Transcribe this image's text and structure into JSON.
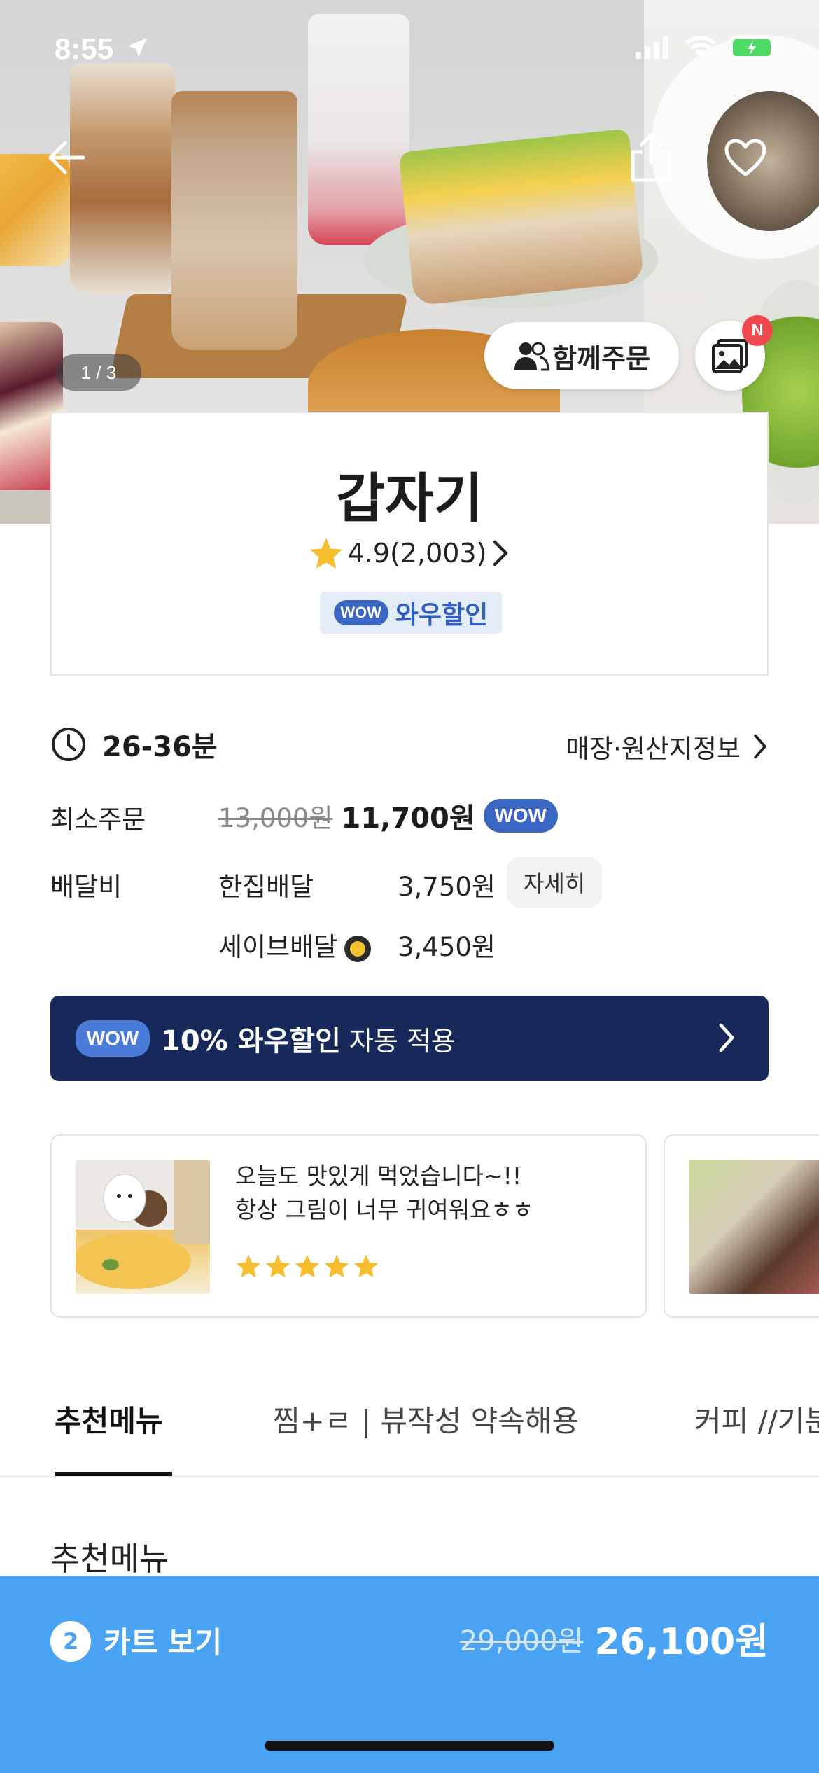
{
  "status_bar": {
    "time": "8:55"
  },
  "hero": {
    "counter": "1 / 3",
    "group_order_label": "함께주문",
    "photo_new_badge": "N"
  },
  "store": {
    "name": "갑자기",
    "rating": "4.9(2,003)",
    "wow_badge": "WOW",
    "wow_discount_label": "와우할인"
  },
  "delivery": {
    "time": "26-36분",
    "store_info_link": "매장·원산지정보",
    "min_order_label": "최소주문",
    "min_order_original": "13,000원",
    "min_order_price": "11,700원",
    "min_order_badge": "WOW",
    "fee_label": "배달비",
    "fee_options": [
      {
        "name": "한집배달",
        "price": "3,750원"
      },
      {
        "name": "세이브배달",
        "price": "3,450원"
      }
    ],
    "detail_button": "자세히"
  },
  "wow_banner": {
    "badge": "WOW",
    "bold_text": "10% 와우할인",
    "rest_text": "자동 적용"
  },
  "reviews": [
    {
      "line1": "오늘도 맛있게 먹었습니다~!!",
      "line2": "항상 그림이 너무 귀여워요ㅎㅎ",
      "stars": 5
    }
  ],
  "tabs": [
    {
      "label": "추천메뉴",
      "active": true
    },
    {
      "label": "찜+ㄹ | 뷰작성 약속해용",
      "active": false
    },
    {
      "label": "커피 //기분",
      "active": false
    }
  ],
  "section_title": "추천메뉴",
  "cart": {
    "count": "2",
    "label": "카트 보기",
    "original_total": "29,000원",
    "total": "26,100원"
  },
  "colors": {
    "wow_blue": "#3b66c4",
    "banner_navy": "#16295a",
    "cart_blue": "#4aa3f2",
    "star_yellow": "#f6be2c",
    "new_badge_red": "#f0494d"
  },
  "icons": [
    "back-arrow-icon",
    "share-icon",
    "heart-icon",
    "people-icon",
    "photo-icon",
    "star-icon",
    "chevron-right-icon",
    "clock-icon",
    "save-delivery-icon",
    "signal-icon",
    "wifi-icon",
    "battery-icon",
    "location-arrow-icon"
  ]
}
